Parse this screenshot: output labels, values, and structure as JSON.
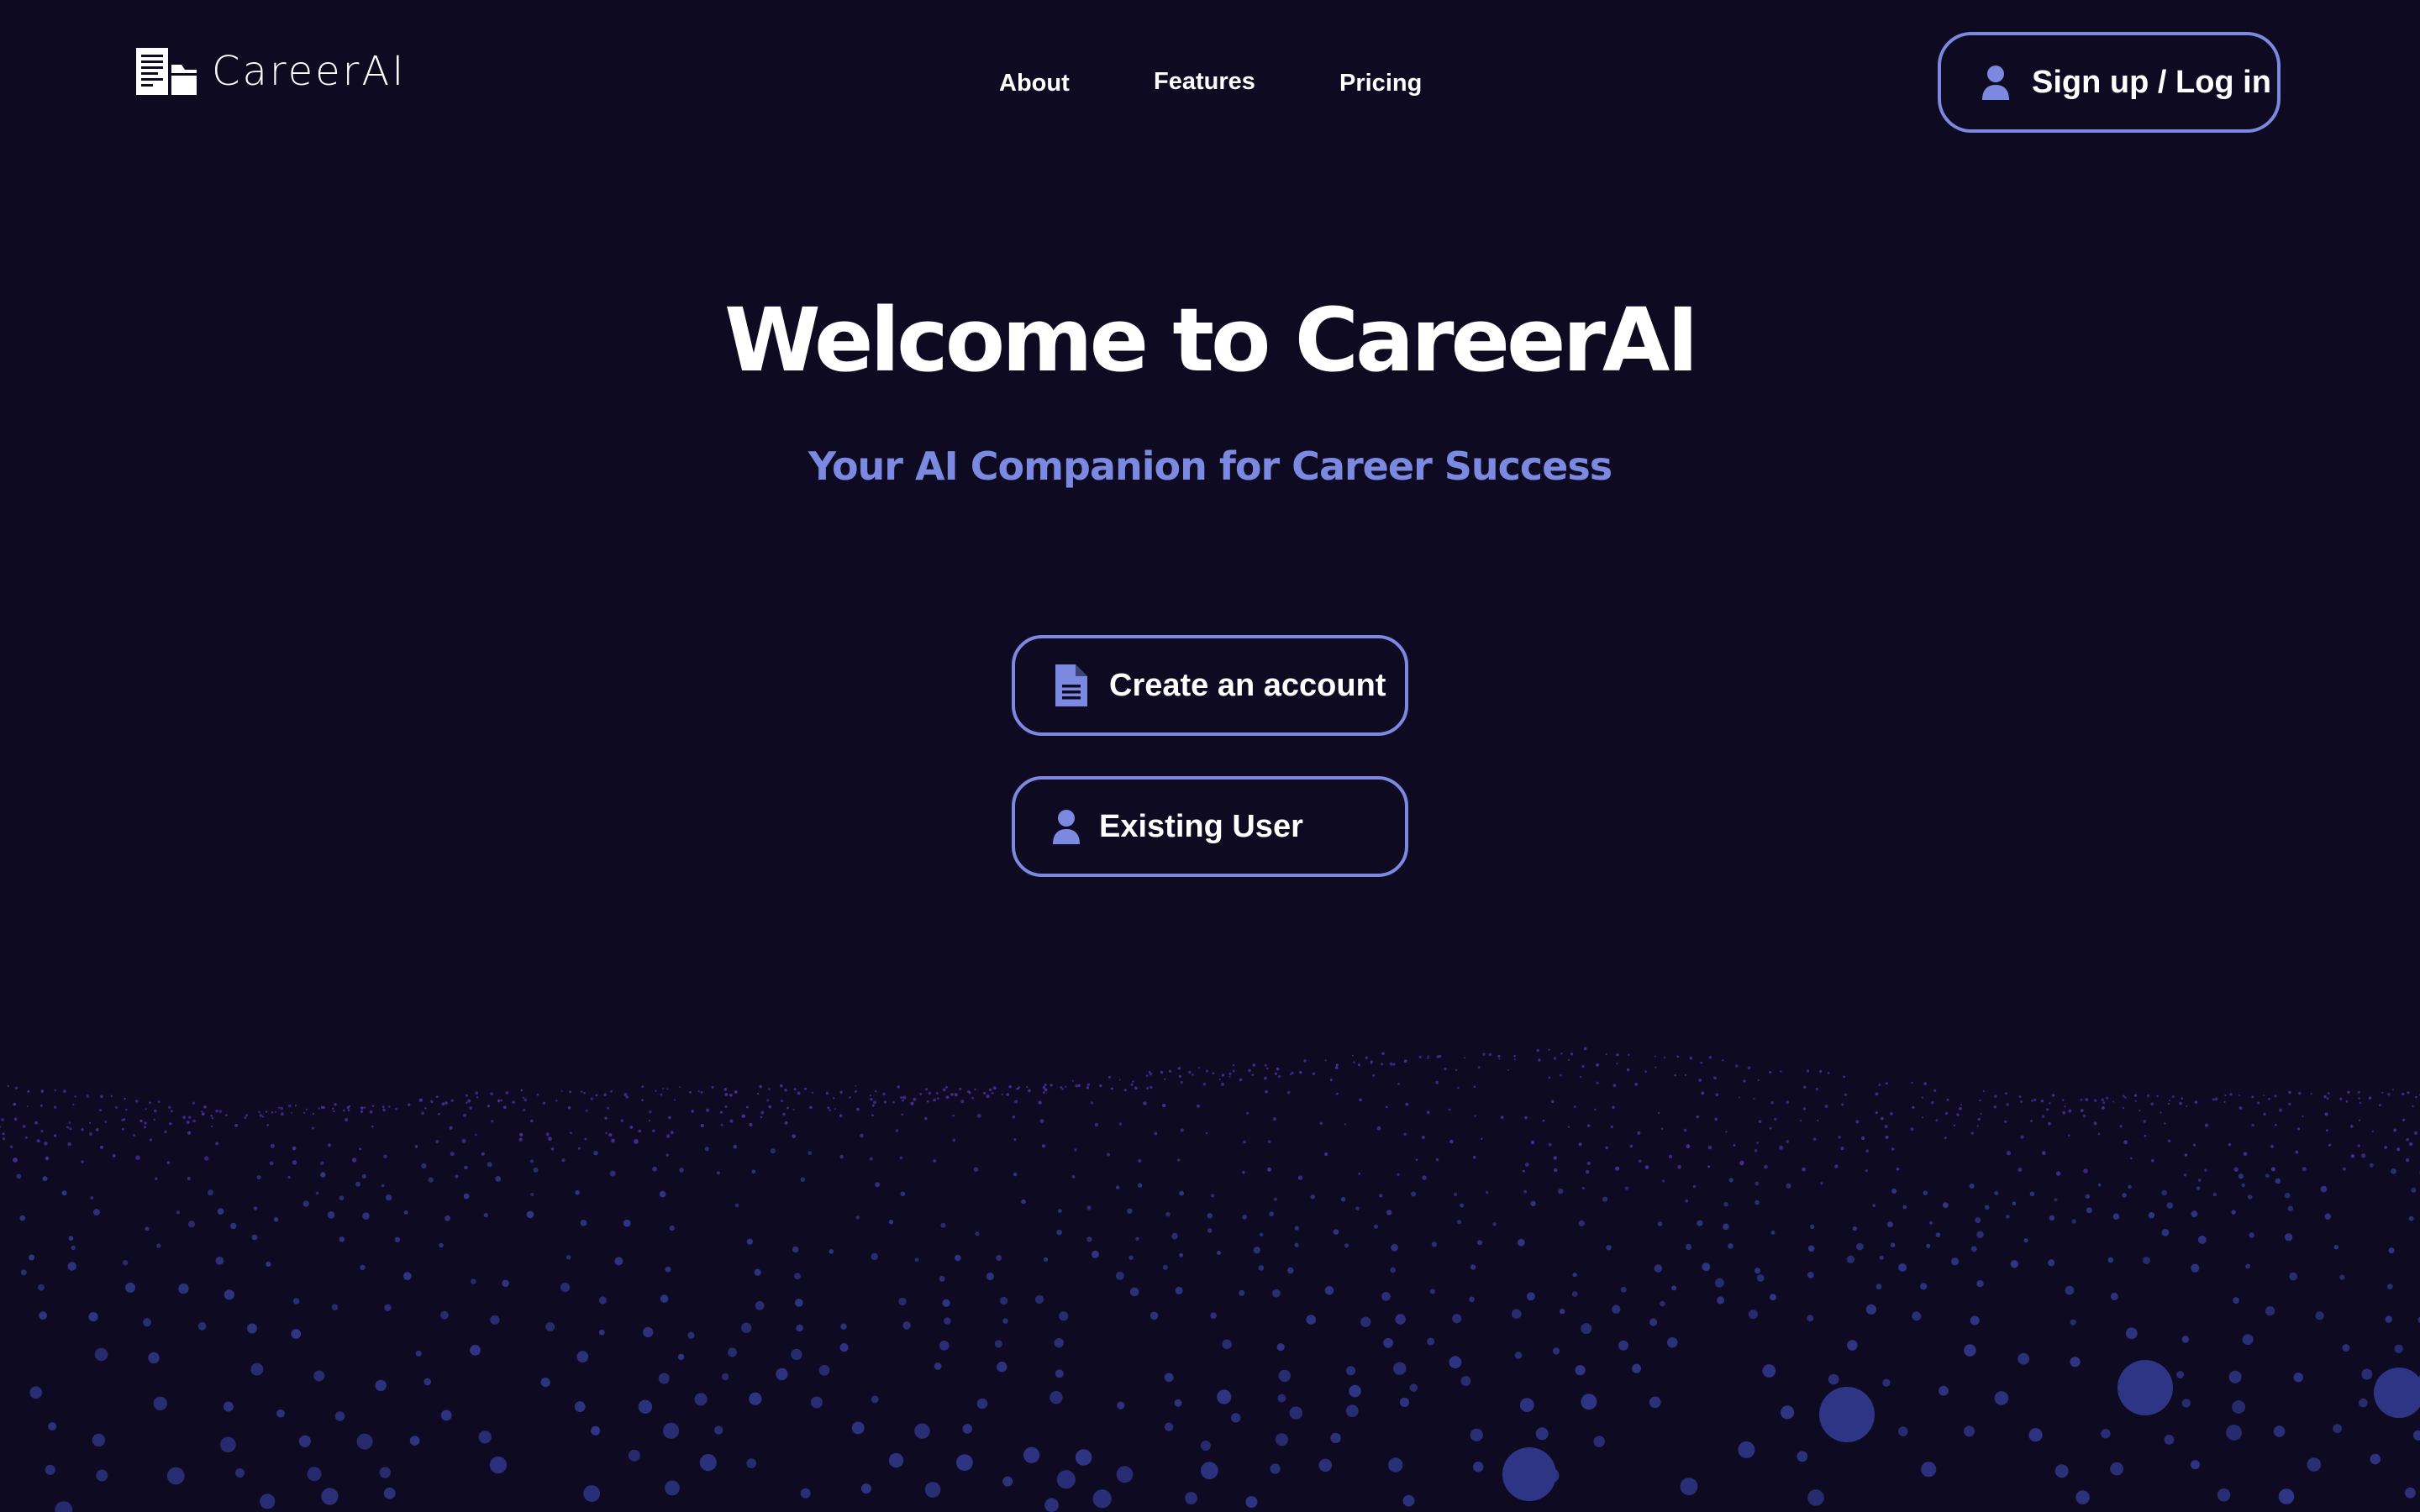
{
  "app": {
    "brand": "CareerAI"
  },
  "nav": {
    "links": [
      {
        "label": "About"
      },
      {
        "label": "Features"
      },
      {
        "label": "Pricing"
      }
    ],
    "login_label": "Sign up / Log in",
    "login_icon": "user-icon"
  },
  "hero": {
    "title": "Welcome to CareerAI",
    "subtitle": "Your AI Companion for Career Success"
  },
  "actions": {
    "create_label": "Create an account",
    "create_icon": "document-icon",
    "existing_label": "Existing User",
    "existing_icon": "user-icon"
  },
  "colors": {
    "background": "#0d0a22",
    "accent": "#7b8ae0",
    "text": "#ffffff",
    "particles_near": "#2f3585",
    "particles_far": "#4a2a9a"
  }
}
